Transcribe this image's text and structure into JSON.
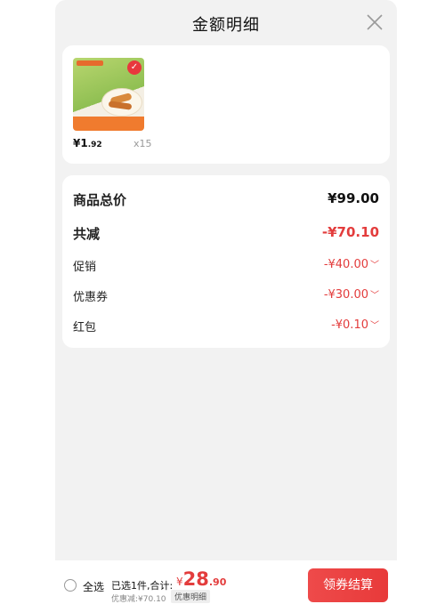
{
  "header": {
    "title": "金额明细",
    "close_icon": "close-icon"
  },
  "product": {
    "price_symbol": "¥",
    "price_int": "1",
    "price_dec": ".92",
    "quantity": "x15",
    "check_icon": "check-icon"
  },
  "summary": {
    "rows": [
      {
        "label": "商品总价",
        "value": "¥99.00",
        "color": "#111111"
      },
      {
        "label": "共减",
        "value": "-¥70.10",
        "color": "#e33c3c"
      },
      {
        "label": "促销",
        "value": "-¥40.00"
      },
      {
        "label": "优惠券",
        "value": "-¥30.00"
      },
      {
        "label": "红包",
        "value": "-¥0.10"
      }
    ],
    "chevron_icon": "chevron-down-icon"
  },
  "bottom_bar": {
    "select_all": "全选",
    "selected_text": "已选1件,合计:",
    "total_symbol": "¥",
    "total_int": "28",
    "total_dec": ".90",
    "discount_text": "优惠减:¥70.10",
    "detail_link": "优惠明细",
    "checkout_button": "领券结算"
  },
  "colors": {
    "accent_red": "#e33c3c",
    "panel_bg": "#f2f2f2"
  }
}
